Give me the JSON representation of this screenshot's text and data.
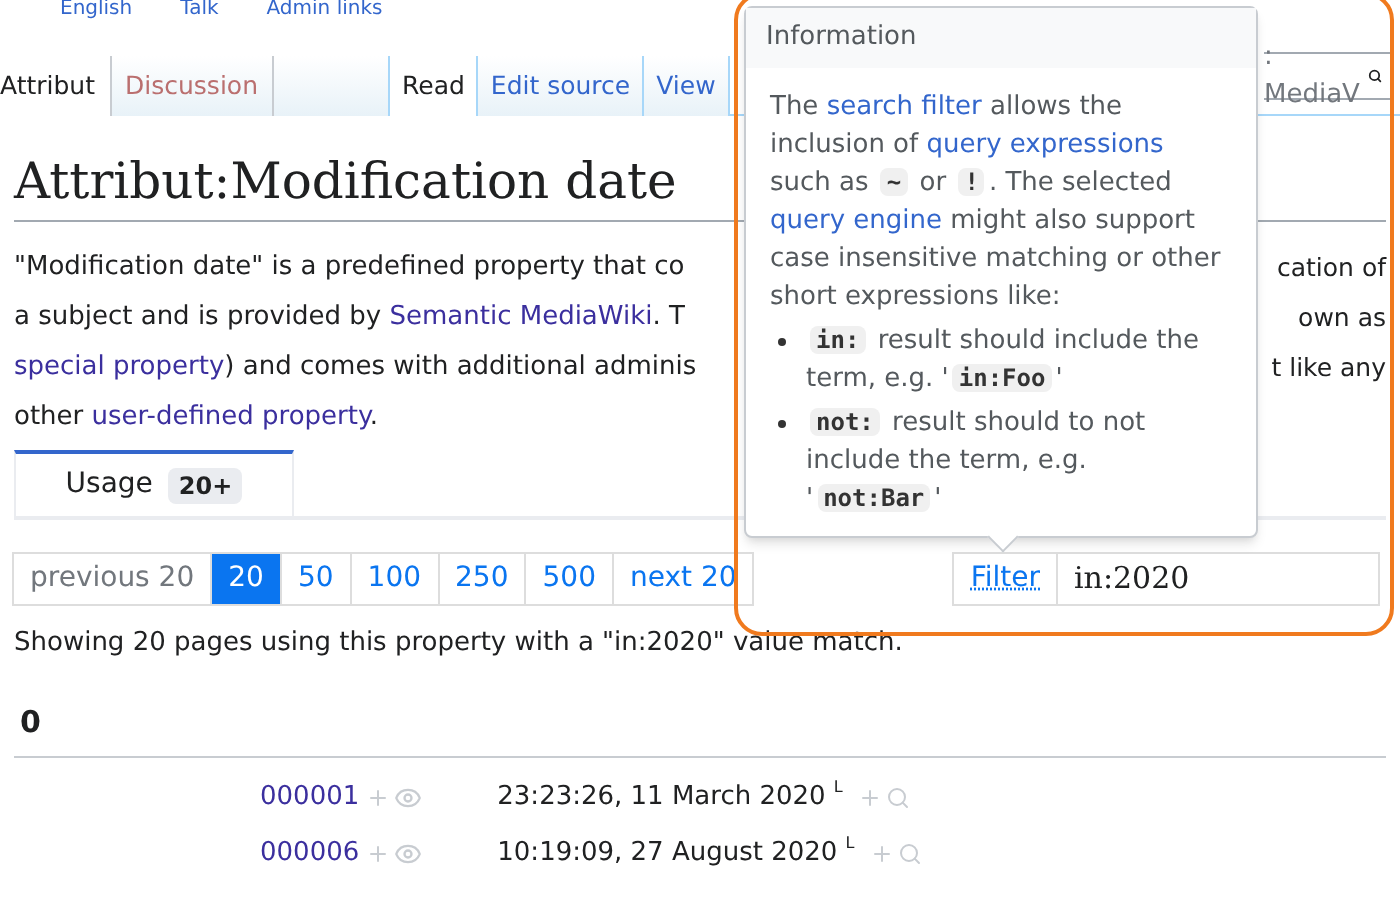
{
  "top_links": [
    "English",
    "Talk",
    "Admin links"
  ],
  "left_tabs": [
    {
      "label": "Attribut",
      "selected": true
    },
    {
      "label": "Discussion",
      "selected": false
    }
  ],
  "right_tabs": [
    {
      "label": "Read",
      "selected": true
    },
    {
      "label": "Edit source",
      "selected": false
    },
    {
      "label": "View",
      "selected": false
    }
  ],
  "search": {
    "placeholder": ": MediaV"
  },
  "title": "Attribut:Modification date",
  "description": [
    {
      "left": [
        {
          "kind": "text",
          "text": "\"Modification date\" is a predefined property that co"
        }
      ],
      "right": "cation of"
    },
    {
      "left": [
        {
          "kind": "text",
          "text": "a subject and is provided by "
        },
        {
          "kind": "link",
          "text": "Semantic MediaWiki"
        },
        {
          "kind": "text",
          "text": ". T"
        }
      ],
      "right": "own as"
    },
    {
      "left": [
        {
          "kind": "link",
          "text": "special property"
        },
        {
          "kind": "text",
          "text": ") and comes with additional adminis"
        }
      ],
      "right": "t like any"
    },
    {
      "left": [
        {
          "kind": "text",
          "text": "other "
        },
        {
          "kind": "link",
          "text": "user-defined property"
        },
        {
          "kind": "text",
          "text": "."
        }
      ]
    }
  ],
  "usage_tab": {
    "label": "Usage",
    "count": "20+",
    "selected": true
  },
  "pagination": [
    {
      "label": "previous 20",
      "selected": false,
      "disabled": true
    },
    {
      "label": "20",
      "selected": true,
      "disabled": false
    },
    {
      "label": "50",
      "selected": false,
      "disabled": false
    },
    {
      "label": "100",
      "selected": false,
      "disabled": false
    },
    {
      "label": "250",
      "selected": false,
      "disabled": false
    },
    {
      "label": "500",
      "selected": false,
      "disabled": false
    },
    {
      "label": "next 20",
      "selected": false,
      "disabled": false
    }
  ],
  "filter": {
    "label": "Filter",
    "value": "in:2020"
  },
  "summary": "Showing 20 pages using this property with a \"in:2020\" value match.",
  "group_heading": "0",
  "rows": [
    {
      "page": "000001",
      "value": "23:23:26, 11 March 2020",
      "mark": "L"
    },
    {
      "page": "000006",
      "value": "10:19:09, 27 August 2020",
      "mark": "L"
    }
  ],
  "popup": {
    "title": "Information",
    "paragraph": [
      {
        "kind": "text",
        "text": "The "
      },
      {
        "kind": "link",
        "text": "search filter"
      },
      {
        "kind": "text",
        "text": " allows the inclusion of "
      },
      {
        "kind": "link",
        "text": "query expressions"
      },
      {
        "kind": "text",
        "text": " such as "
      },
      {
        "kind": "code",
        "text": "~"
      },
      {
        "kind": "text",
        "text": " or "
      },
      {
        "kind": "code",
        "text": "!"
      },
      {
        "kind": "text",
        "text": ". The selected "
      },
      {
        "kind": "link",
        "text": "query engine"
      },
      {
        "kind": "text",
        "text": " might also support case insensitive matching or other short expressions like:"
      }
    ],
    "items": [
      [
        {
          "kind": "code",
          "text": "in:"
        },
        {
          "kind": "text",
          "text": " result should include the term, e.g. '"
        },
        {
          "kind": "code",
          "text": "in:Foo"
        },
        {
          "kind": "text",
          "text": "'"
        }
      ],
      [
        {
          "kind": "code",
          "text": "not:"
        },
        {
          "kind": "text",
          "text": " result should to not include the term, e.g. '"
        },
        {
          "kind": "code",
          "text": "not:Bar"
        },
        {
          "kind": "text",
          "text": "'"
        }
      ]
    ]
  }
}
